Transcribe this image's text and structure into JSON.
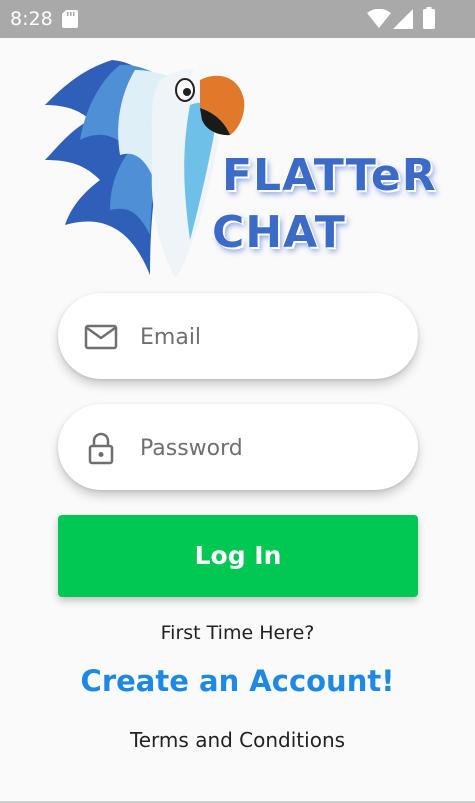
{
  "status_bar": {
    "time": "8:28",
    "icons": [
      "sd-card-icon",
      "wifi-icon",
      "signal-icon",
      "battery-icon"
    ]
  },
  "logo": {
    "line1": "FLATTeR",
    "line2": "CHAT",
    "text_color": "#3b6bc6"
  },
  "email": {
    "placeholder": "Email",
    "value": "",
    "icon": "mail-icon"
  },
  "password": {
    "placeholder": "Password",
    "value": "",
    "icon": "lock-icon"
  },
  "login": {
    "label": "Log In",
    "color": "#00c853"
  },
  "prompt": {
    "first_time": "First Time Here?",
    "create_account": "Create an Account!",
    "link_color": "#1e88e5"
  },
  "footer": {
    "terms": "Terms and Conditions"
  }
}
